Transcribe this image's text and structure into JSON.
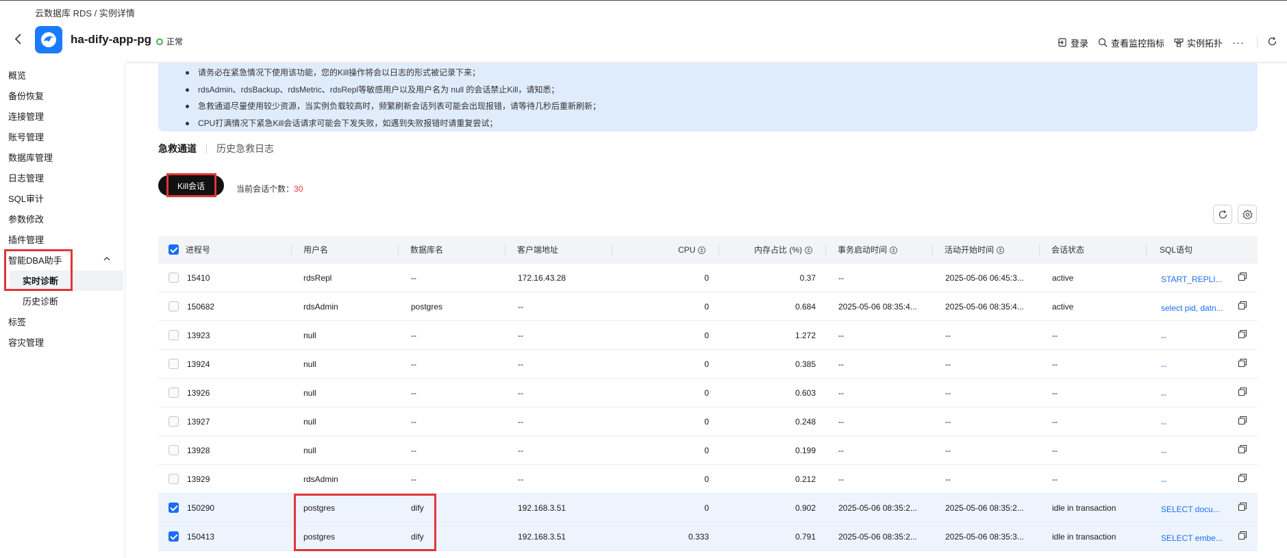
{
  "breadcrumb": "云数据库 RDS / 实例详情",
  "instance": {
    "name": "ha-dify-app-pg",
    "status": "正常"
  },
  "header_actions": {
    "login": "登录",
    "monitor": "查看监控指标",
    "topology": "实例拓扑",
    "more": "···"
  },
  "sidebar": {
    "items": [
      "概览",
      "备份恢复",
      "连接管理",
      "账号管理",
      "数据库管理",
      "日志管理",
      "SQL审计",
      "参数修改",
      "插件管理",
      "智能DBA助手"
    ],
    "sub_items": [
      "实时诊断",
      "历史诊断"
    ],
    "items_after": [
      "标签",
      "容灾管理"
    ]
  },
  "notice": [
    "请务必在紧急情况下使用该功能，您的Kill操作将会以日志的形式被记录下来；",
    "rdsAdmin、rdsBackup、rdsMetric、rdsRepl等敏感用户以及用户名为 null 的会话禁止Kill，请知悉；",
    "急救通道尽量使用较少资源，当实例负载较高时，频繁刷新会话列表可能会出现报错，请等待几秒后重新刷新；",
    "CPU打满情况下紧急Kill会话请求可能会下发失败，如遇到失败报错时请重复尝试；"
  ],
  "tabs": {
    "rescue": "急救通道",
    "history": "历史急救日志"
  },
  "kill_button": "Kill会话",
  "session_count": {
    "label": "当前会话个数：",
    "value": "30"
  },
  "table": {
    "headers": [
      "进程号",
      "用户名",
      "数据库名",
      "客户端地址",
      "CPU",
      "内存占比 (%)",
      "事务启动时间",
      "活动开始时间",
      "会话状态",
      "SQL语句"
    ],
    "rows": [
      {
        "checked": false,
        "pid": "15410",
        "user": "rdsRepl",
        "db": "--",
        "client": "172.16.43.28",
        "cpu": "0",
        "mem": "0.37",
        "txn": "--",
        "act": "2025-05-06 06:45:3...",
        "state": "active",
        "sql": "START_REPLI..."
      },
      {
        "checked": false,
        "pid": "150682",
        "user": "rdsAdmin",
        "db": "postgres",
        "client": "--",
        "cpu": "0",
        "mem": "0.684",
        "txn": "2025-05-06 08:35:4...",
        "act": "2025-05-06 08:35:4...",
        "state": "active",
        "sql": "select pid, datn..."
      },
      {
        "checked": false,
        "pid": "13923",
        "user": "null",
        "db": "--",
        "client": "--",
        "cpu": "0",
        "mem": "1.272",
        "txn": "--",
        "act": "--",
        "state": "--",
        "sql": "--"
      },
      {
        "checked": false,
        "pid": "13924",
        "user": "null",
        "db": "--",
        "client": "--",
        "cpu": "0",
        "mem": "0.385",
        "txn": "--",
        "act": "--",
        "state": "--",
        "sql": "--"
      },
      {
        "checked": false,
        "pid": "13926",
        "user": "null",
        "db": "--",
        "client": "--",
        "cpu": "0",
        "mem": "0.603",
        "txn": "--",
        "act": "--",
        "state": "--",
        "sql": "--"
      },
      {
        "checked": false,
        "pid": "13927",
        "user": "null",
        "db": "--",
        "client": "--",
        "cpu": "0",
        "mem": "0.248",
        "txn": "--",
        "act": "--",
        "state": "--",
        "sql": "--"
      },
      {
        "checked": false,
        "pid": "13928",
        "user": "null",
        "db": "--",
        "client": "--",
        "cpu": "0",
        "mem": "0.199",
        "txn": "--",
        "act": "--",
        "state": "--",
        "sql": "--"
      },
      {
        "checked": false,
        "pid": "13929",
        "user": "rdsAdmin",
        "db": "--",
        "client": "--",
        "cpu": "0",
        "mem": "0.212",
        "txn": "--",
        "act": "--",
        "state": "--",
        "sql": "--"
      },
      {
        "checked": true,
        "pid": "150290",
        "user": "postgres",
        "db": "dify",
        "client": "192.168.3.51",
        "cpu": "0",
        "mem": "0.902",
        "txn": "2025-05-06 08:35:2...",
        "act": "2025-05-06 08:35:2...",
        "state": "idle in transaction",
        "sql": "SELECT docu..."
      },
      {
        "checked": true,
        "pid": "150413",
        "user": "postgres",
        "db": "dify",
        "client": "192.168.3.51",
        "cpu": "0.333",
        "mem": "0.791",
        "txn": "2025-05-06 08:35:2...",
        "act": "2025-05-06 08:35:3...",
        "state": "idle in transaction",
        "sql": "SELECT embe..."
      }
    ]
  },
  "colors": {
    "accent": "#1a6ef5",
    "highlight": "#e23535",
    "notice_bg": "#dfecfc",
    "status_ok": "#4caf50"
  },
  "icons": [
    "back-icon",
    "rds-logo-icon",
    "login-icon",
    "monitor-icon",
    "topology-icon",
    "refresh-icon",
    "settings-icon",
    "sort-icon",
    "copy-icon",
    "chevron-up-icon"
  ]
}
